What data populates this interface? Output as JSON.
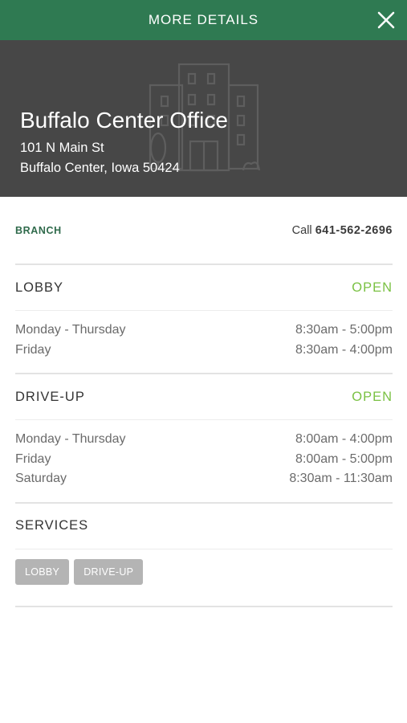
{
  "header": {
    "title": "MORE DETAILS",
    "close_icon": "close-icon"
  },
  "location": {
    "name": "Buffalo Center Office",
    "address_line1": "101 N Main St",
    "address_line2": "Buffalo Center, Iowa 50424",
    "illustration": "building-icon"
  },
  "branch": {
    "type_label": "BRANCH",
    "call_prefix": "Call",
    "phone": "641-562-2696"
  },
  "lobby": {
    "title": "LOBBY",
    "status": "OPEN",
    "hours": [
      {
        "days": "Monday - Thursday",
        "time": "8:30am - 5:00pm"
      },
      {
        "days": "Friday",
        "time": "8:30am - 4:00pm"
      }
    ]
  },
  "driveup": {
    "title": "DRIVE-UP",
    "status": "OPEN",
    "hours": [
      {
        "days": "Monday - Thursday",
        "time": "8:00am - 4:00pm"
      },
      {
        "days": "Friday",
        "time": "8:00am - 5:00pm"
      },
      {
        "days": "Saturday",
        "time": "8:30am - 11:30am"
      }
    ]
  },
  "services": {
    "title": "SERVICES",
    "tags": [
      "LOBBY",
      "DRIVE-UP"
    ]
  },
  "colors": {
    "header_bg": "#2f7a52",
    "hero_bg": "#474747",
    "open_status": "#7ac143",
    "tag_bg": "#b4b4b4"
  }
}
